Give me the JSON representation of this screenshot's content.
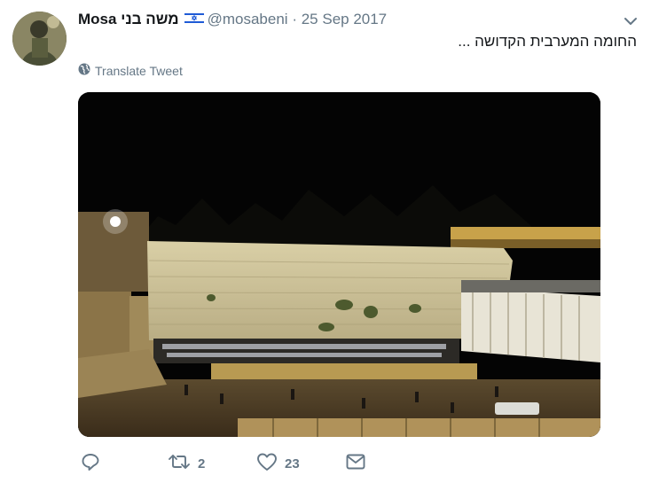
{
  "tweet": {
    "author_name": "Mosa משה בני",
    "handle": "@mosabeni",
    "separator": "·",
    "date": "25 Sep 2017",
    "text": "החומה המערבית הקדושה ...",
    "translate_label": "Translate Tweet"
  },
  "actions": {
    "reply_count": "",
    "retweet_count": "2",
    "like_count": "23"
  },
  "icons": {
    "flag": "israel-flag-icon",
    "menu": "chevron-down-icon",
    "translate": "globe-icon",
    "reply": "reply-icon",
    "retweet": "retweet-icon",
    "like": "heart-icon",
    "dm": "envelope-icon"
  },
  "colors": {
    "text_primary": "#14171a",
    "text_secondary": "#657786",
    "photo_sky": "#040404",
    "wall": "#cfc49e"
  }
}
